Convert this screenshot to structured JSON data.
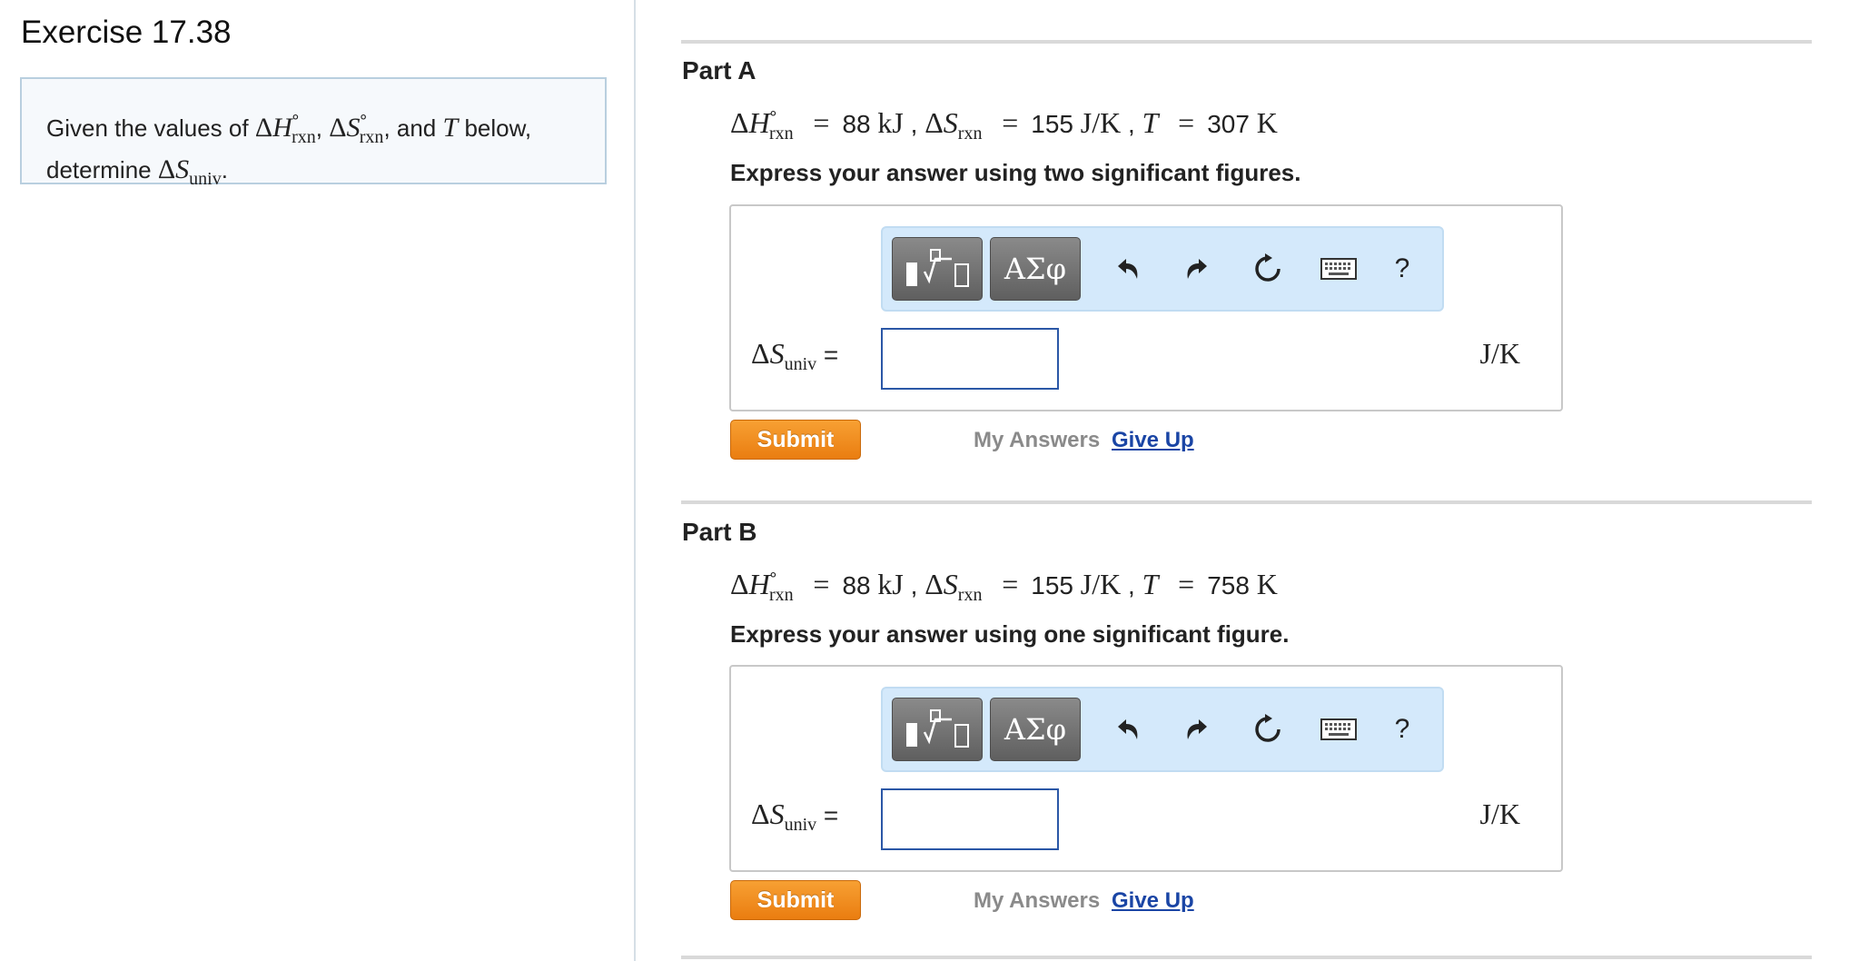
{
  "exercise": {
    "title": "Exercise 17.38",
    "problem_prefix": "Given the values of",
    "problem_and": "and",
    "problem_below": "below,",
    "problem_determine": "determine"
  },
  "parts": [
    {
      "title": "Part A",
      "dH_value": "88",
      "dH_unit": "kJ",
      "dS_value": "155",
      "dS_unit": "J/K",
      "T_value": "307",
      "T_unit": "K",
      "instruction": "Express your answer using two significant figures.",
      "input_value": "",
      "units": "J/K",
      "submit_label": "Submit",
      "my_answers_label": "My Answers",
      "give_up_label": "Give Up"
    },
    {
      "title": "Part B",
      "dH_value": "88",
      "dH_unit": "kJ",
      "dS_value": "155",
      "dS_unit": "J/K",
      "T_value": "758",
      "T_unit": "K",
      "instruction": "Express your answer using one significant figure.",
      "input_value": "",
      "units": "J/K",
      "submit_label": "Submit",
      "my_answers_label": "My Answers",
      "give_up_label": "Give Up"
    }
  ],
  "toolbar": {
    "greek_label": "ΑΣφ",
    "help_label": "?",
    "icons": [
      "templates-icon",
      "greek-symbols-icon",
      "undo-icon",
      "redo-icon",
      "reset-icon",
      "keyboard-icon",
      "help-icon"
    ]
  },
  "colors": {
    "submit": "#f0891f",
    "link": "#1a45a5",
    "toolbar_bg": "#d4e9fb",
    "input_border": "#2b57a6",
    "problem_border": "#b9cfdf"
  }
}
